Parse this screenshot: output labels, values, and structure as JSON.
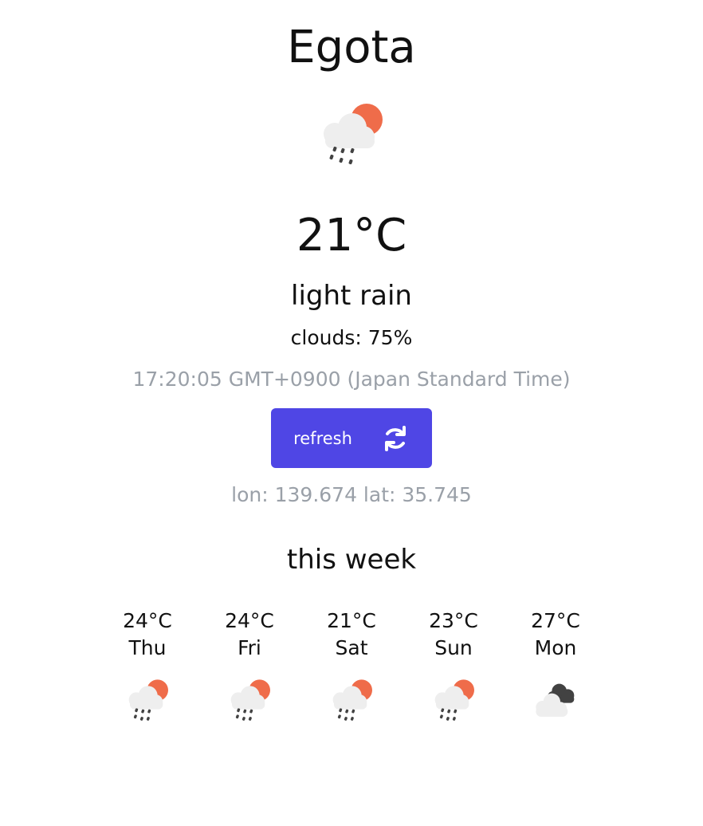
{
  "location": {
    "city": "Egota"
  },
  "current": {
    "icon": "rain-cloud-sun-icon",
    "temperature": "21°C",
    "description": "light rain",
    "clouds": "clouds: 75%",
    "time": "17:20:05 GMT+0900 (Japan Standard Time)",
    "coords": "lon: 139.674 lat: 35.745"
  },
  "actions": {
    "refresh_label": "refresh",
    "refresh_icon": "refresh-icon"
  },
  "week": {
    "title": "this week",
    "days": [
      {
        "temp": "24°C",
        "day": "Thu",
        "icon": "rain-cloud-sun-icon"
      },
      {
        "temp": "24°C",
        "day": "Fri",
        "icon": "rain-cloud-sun-icon"
      },
      {
        "temp": "21°C",
        "day": "Sat",
        "icon": "rain-cloud-sun-icon"
      },
      {
        "temp": "23°C",
        "day": "Sun",
        "icon": "rain-cloud-sun-icon"
      },
      {
        "temp": "27°C",
        "day": "Mon",
        "icon": "dark-clouds-icon"
      }
    ]
  },
  "colors": {
    "accent": "#4f46e5",
    "sun": "#ef6c4a",
    "cloud": "#eeeeee",
    "dark_cloud": "#424242",
    "muted_text": "#9aa0a8"
  }
}
